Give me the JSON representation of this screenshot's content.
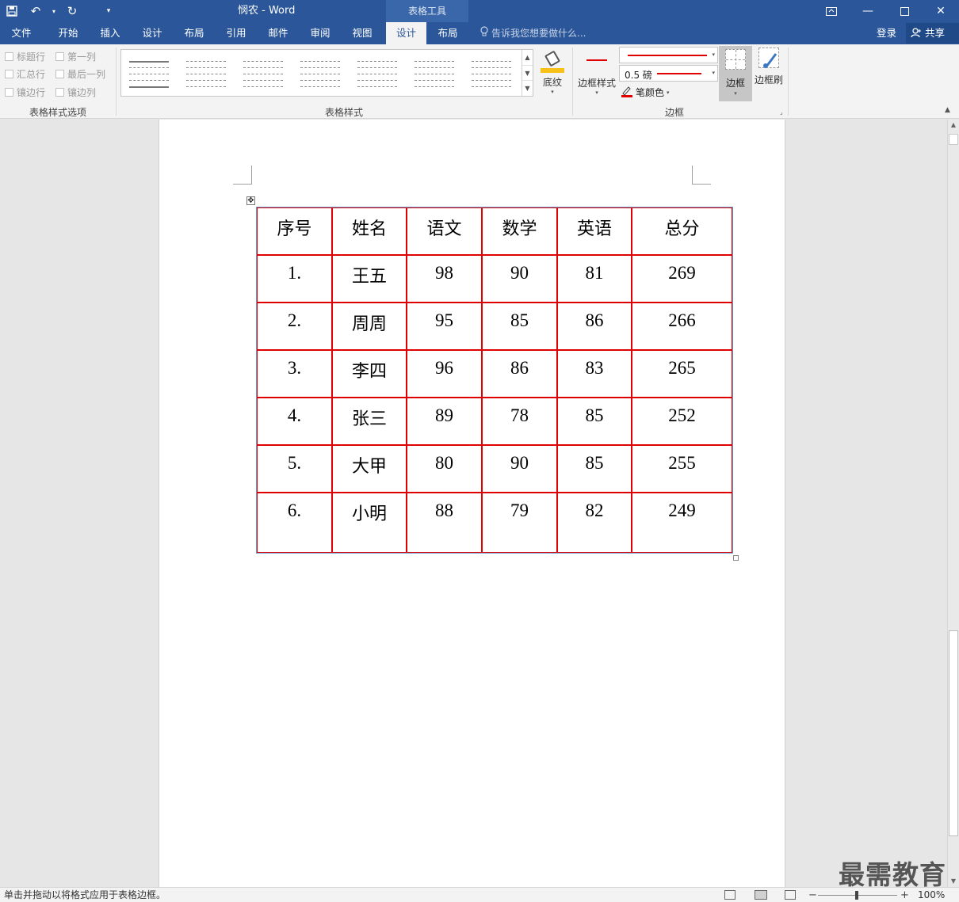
{
  "titlebar": {
    "doc_title": "悯农 - Word",
    "context_tab": "表格工具"
  },
  "tabs": [
    {
      "label": "文件"
    },
    {
      "label": "开始"
    },
    {
      "label": "插入"
    },
    {
      "label": "设计"
    },
    {
      "label": "布局"
    },
    {
      "label": "引用"
    },
    {
      "label": "邮件"
    },
    {
      "label": "审阅"
    },
    {
      "label": "视图"
    },
    {
      "label": "设计"
    },
    {
      "label": "布局"
    }
  ],
  "tell_me": "告诉我您想要做什么...",
  "login": "登录",
  "share": "共享",
  "ribbon": {
    "style_options": {
      "group_label": "表格样式选项",
      "checkboxes": [
        "标题行",
        "第一列",
        "汇总行",
        "最后一列",
        "镶边行",
        "镶边列"
      ]
    },
    "table_styles": {
      "group_label": "表格样式"
    },
    "shading_label": "底纹",
    "border_styles_label": "边框样式",
    "pen_weight": "0.5 磅",
    "pen_color_label": "笔颜色",
    "borders_label": "边框",
    "border_painter_label": "边框刷",
    "borders_group_label": "边框"
  },
  "table": {
    "headers": [
      "序号",
      "姓名",
      "语文",
      "数学",
      "英语",
      "总分"
    ],
    "rows": [
      [
        "1.",
        "王五",
        "98",
        "90",
        "81",
        "269"
      ],
      [
        "2.",
        "周周",
        "95",
        "85",
        "86",
        "266"
      ],
      [
        "3.",
        "李四",
        "96",
        "86",
        "83",
        "265"
      ],
      [
        "4.",
        "张三",
        "89",
        "78",
        "85",
        "252"
      ],
      [
        "5.",
        "大甲",
        "80",
        "90",
        "85",
        "255"
      ],
      [
        "6.",
        "小明",
        "88",
        "79",
        "82",
        "249"
      ]
    ]
  },
  "status": {
    "text": "单击并拖动以将格式应用于表格边框。",
    "zoom": "100%"
  },
  "watermark": "最需教育",
  "colors": {
    "brand": "#2b579a",
    "table_border": "#e00000",
    "shading": "#f7c11a"
  }
}
